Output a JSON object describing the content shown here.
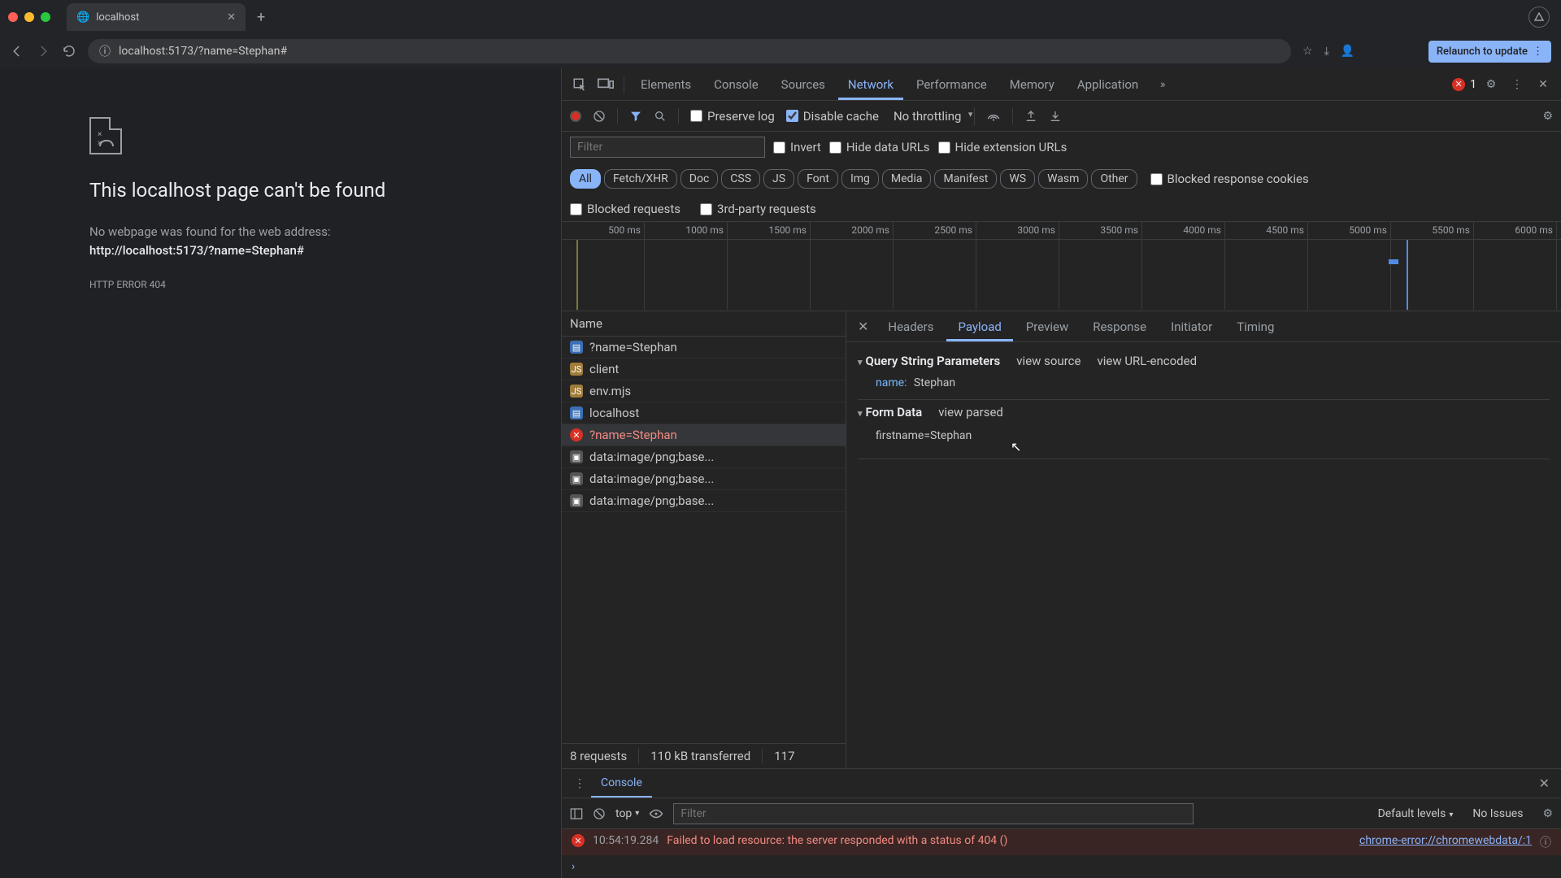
{
  "browser": {
    "tab_title": "localhost",
    "url": "localhost:5173/?name=Stephan#",
    "relaunch_label": "Relaunch to update"
  },
  "error_page": {
    "heading": "This localhost page can't be found",
    "body_prefix": "No webpage was found for the web address:",
    "url": "http://localhost:5173/?name=Stephan#",
    "code": "HTTP ERROR 404"
  },
  "devtools": {
    "tabs": [
      "Elements",
      "Console",
      "Sources",
      "Network",
      "Performance",
      "Memory",
      "Application"
    ],
    "active_tab": "Network",
    "error_count": "1"
  },
  "net_toolbar": {
    "preserve_log": "Preserve log",
    "disable_cache": "Disable cache",
    "throttling": "No throttling"
  },
  "filter": {
    "placeholder": "Filter",
    "invert": "Invert",
    "hide_data_urls": "Hide data URLs",
    "hide_ext_urls": "Hide extension URLs",
    "types": [
      "All",
      "Fetch/XHR",
      "Doc",
      "CSS",
      "JS",
      "Font",
      "Img",
      "Media",
      "Manifest",
      "WS",
      "Wasm",
      "Other"
    ],
    "blocked_cookies": "Blocked response cookies",
    "blocked_requests": "Blocked requests",
    "third_party": "3rd-party requests"
  },
  "waterfall_ticks": [
    "500 ms",
    "1000 ms",
    "1500 ms",
    "2000 ms",
    "2500 ms",
    "3000 ms",
    "3500 ms",
    "4000 ms",
    "4500 ms",
    "5000 ms",
    "5500 ms",
    "6000 ms"
  ],
  "requests": {
    "header": "Name",
    "rows": [
      {
        "icon": "doc",
        "name": "?name=Stephan"
      },
      {
        "icon": "js",
        "name": "client"
      },
      {
        "icon": "js",
        "name": "env.mjs"
      },
      {
        "icon": "doc",
        "name": "localhost"
      },
      {
        "icon": "err",
        "name": "?name=Stephan",
        "error": true,
        "selected": true
      },
      {
        "icon": "img",
        "name": "data:image/png;base..."
      },
      {
        "icon": "img",
        "name": "data:image/png;base..."
      },
      {
        "icon": "img",
        "name": "data:image/png;base..."
      }
    ],
    "status": {
      "count": "8 requests",
      "transferred": "110 kB transferred",
      "resources": "117"
    }
  },
  "detail": {
    "tabs": [
      "Headers",
      "Payload",
      "Preview",
      "Response",
      "Initiator",
      "Timing"
    ],
    "active_tab": "Payload",
    "query_heading": "Query String Parameters",
    "view_source": "view source",
    "view_url_encoded": "view URL-encoded",
    "query_key": "name:",
    "query_val": "Stephan",
    "form_heading": "Form Data",
    "view_parsed": "view parsed",
    "form_raw": "firstname=Stephan"
  },
  "drawer": {
    "tab": "Console",
    "context": "top",
    "filter_placeholder": "Filter",
    "levels": "Default levels",
    "issues": "No Issues",
    "msg_ts": "10:54:19.284",
    "msg_text": "Failed to load resource: the server responded with a status of 404 ()",
    "msg_src": "chrome-error://chromewebdata/:1"
  }
}
